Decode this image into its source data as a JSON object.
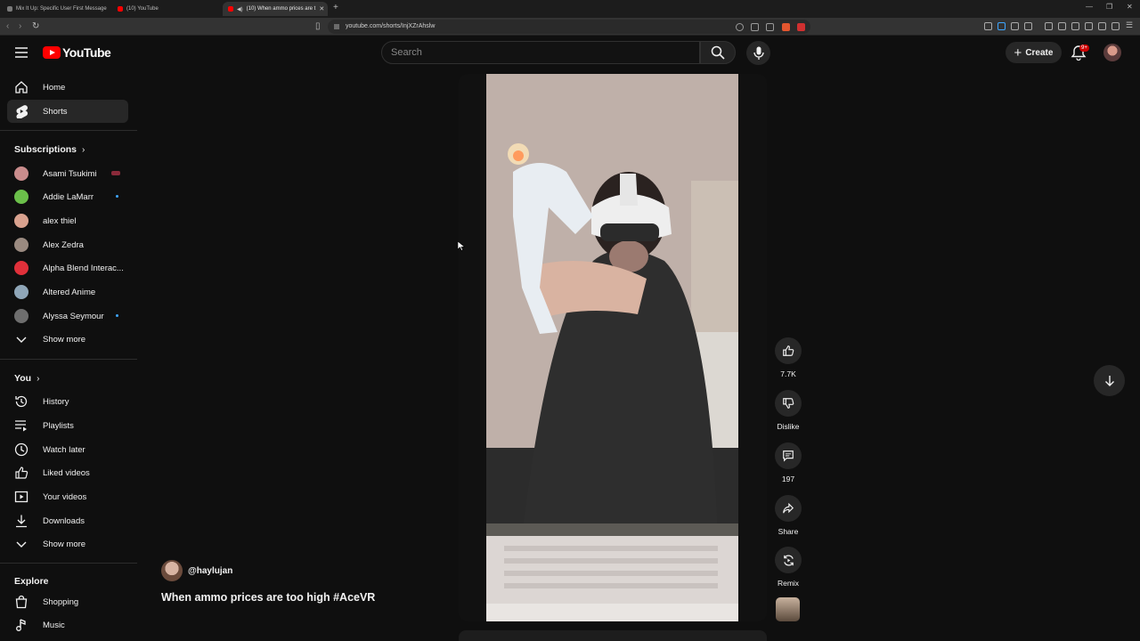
{
  "browser": {
    "tabs": [
      {
        "title": "Mix It Up: Specific User First Message",
        "favicon_color": "#7a7a7a"
      },
      {
        "title": "(10) YouTube",
        "favicon_color": "#ff0000"
      },
      {
        "title": "(10) When ammo prices are t",
        "favicon_color": "#ff0000"
      }
    ],
    "url": "youtube.com/shorts/InjXZrAhslw"
  },
  "header": {
    "logo_text": "YouTube",
    "search_placeholder": "Search",
    "create_label": "Create",
    "notification_badge": "9+"
  },
  "sidebar": {
    "main": [
      {
        "label": "Home",
        "icon": "home-icon"
      },
      {
        "label": "Shorts",
        "icon": "shorts-icon",
        "active": true
      }
    ],
    "subscriptions_heading": "Subscriptions",
    "subscriptions": [
      {
        "label": "Asami Tsukimi",
        "color": "#c98c8c",
        "live": true
      },
      {
        "label": "Addie LaMarr",
        "color": "#6bbf4a",
        "dot": true
      },
      {
        "label": "alex thiel",
        "color": "#d9a28f"
      },
      {
        "label": "Alex Zedra",
        "color": "#9a8a80"
      },
      {
        "label": "Alpha Blend Interac...",
        "color": "#e0303a"
      },
      {
        "label": "Altered Anime",
        "color": "#8fa6b8"
      },
      {
        "label": "Alyssa Seymour",
        "color": "#6e6e6e",
        "dot": true
      }
    ],
    "subs_show_more": "Show more",
    "you_heading": "You",
    "you_items": [
      {
        "label": "History",
        "icon": "history-icon"
      },
      {
        "label": "Playlists",
        "icon": "playlists-icon"
      },
      {
        "label": "Watch later",
        "icon": "watch-later-icon"
      },
      {
        "label": "Liked videos",
        "icon": "thumbs-up-icon"
      },
      {
        "label": "Your videos",
        "icon": "your-videos-icon"
      },
      {
        "label": "Downloads",
        "icon": "download-icon"
      }
    ],
    "you_show_more": "Show more",
    "explore_heading": "Explore",
    "explore_items": [
      {
        "label": "Shopping",
        "icon": "shopping-bag-icon"
      },
      {
        "label": "Music",
        "icon": "music-note-icon"
      }
    ]
  },
  "short": {
    "channel": "@haylujan",
    "title": "When ammo prices are too high #AceVR",
    "likes": "7.7K",
    "dislike_label": "Dislike",
    "comments": "197",
    "share_label": "Share",
    "remix_label": "Remix"
  }
}
